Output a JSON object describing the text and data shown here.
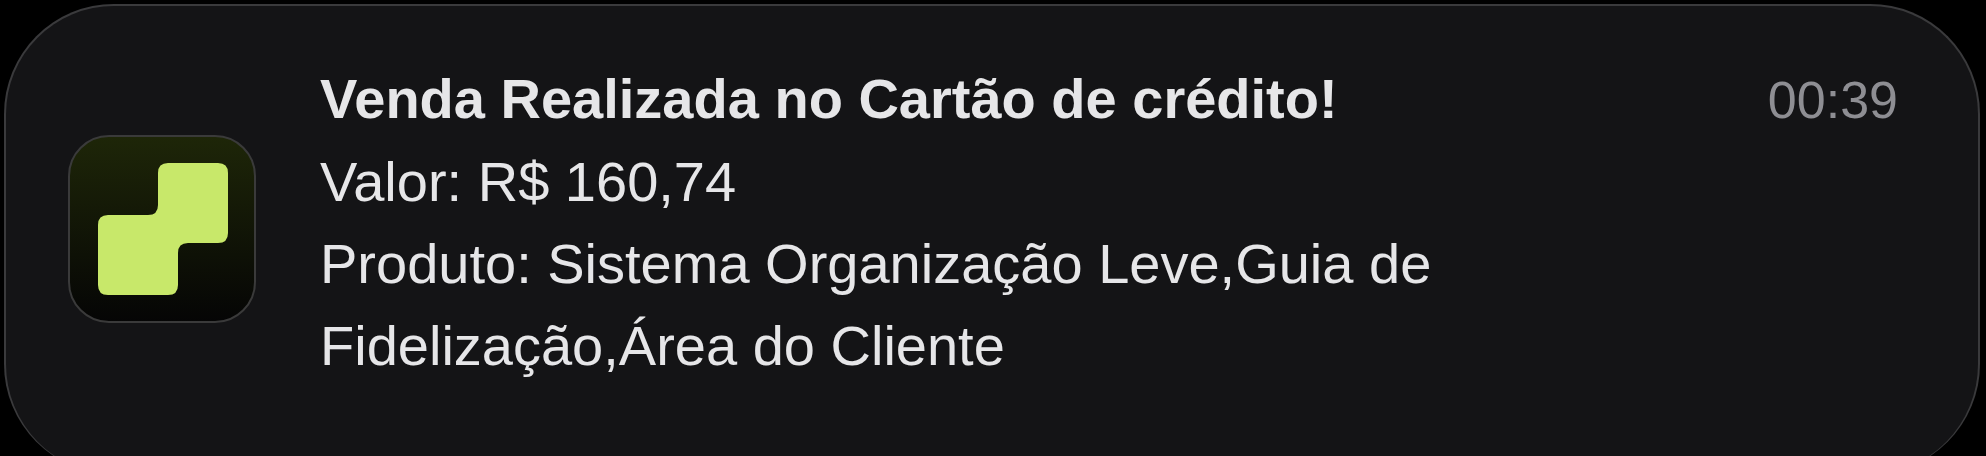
{
  "notification": {
    "title": "Venda Realizada no Cartão de crédito!",
    "time": "00:39",
    "lines": [
      "Valor: R$ 160,74",
      "Produto: Sistema Organização Leve,Guia de Fidelização,Área do Cliente"
    ]
  }
}
